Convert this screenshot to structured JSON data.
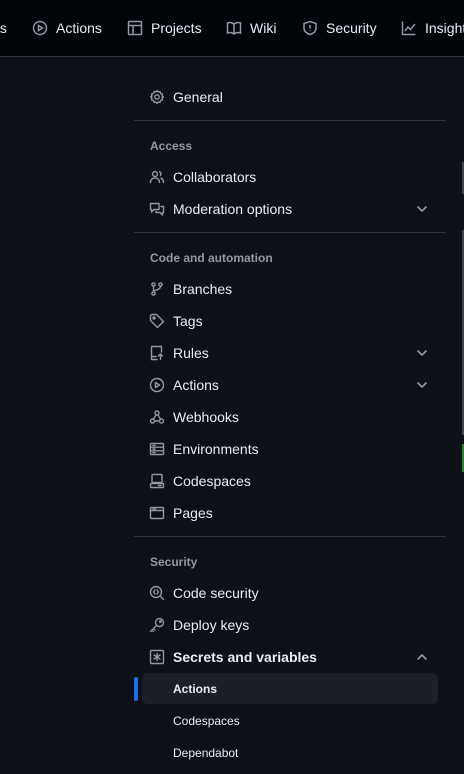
{
  "top_nav": {
    "tabs": [
      {
        "label": "ts",
        "icon": "none"
      },
      {
        "label": "Actions",
        "icon": "play-icon"
      },
      {
        "label": "Projects",
        "icon": "table-icon"
      },
      {
        "label": "Wiki",
        "icon": "book-icon"
      },
      {
        "label": "Security",
        "icon": "shield-icon"
      },
      {
        "label": "Insights",
        "icon": "graph-icon"
      }
    ]
  },
  "menu": {
    "general": "General",
    "access_heading": "Access",
    "collaborators": "Collaborators",
    "moderation": "Moderation options",
    "code_heading": "Code and automation",
    "branches": "Branches",
    "tags": "Tags",
    "rules": "Rules",
    "actions": "Actions",
    "webhooks": "Webhooks",
    "environments": "Environments",
    "codespaces": "Codespaces",
    "pages": "Pages",
    "security_heading": "Security",
    "code_security": "Code security",
    "deploy_keys": "Deploy keys",
    "secrets": "Secrets and variables",
    "secrets_sub": [
      "Actions",
      "Codespaces",
      "Dependabot"
    ]
  },
  "colors": {
    "background": "#0d1117",
    "accent": "#1f6feb",
    "muted": "#9198a1"
  }
}
